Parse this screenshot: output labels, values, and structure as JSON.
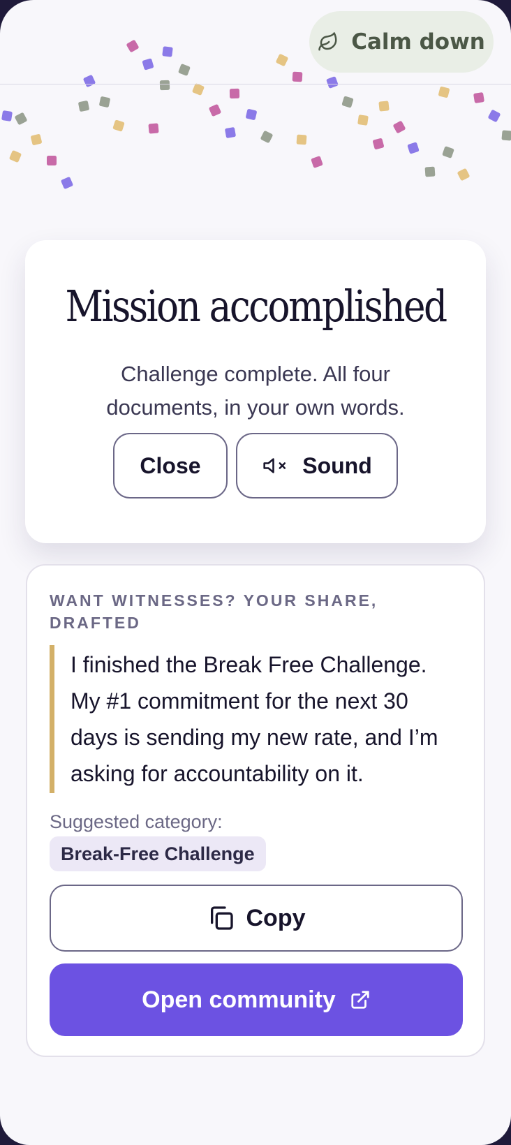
{
  "calm": {
    "label": "Calm down",
    "icon": "leaf-icon"
  },
  "hero": {
    "title": "Mission accomplished",
    "subtitle": "Challenge complete. All four documents, in your own words.",
    "close_label": "Close",
    "sound_label": "Sound",
    "sound_icon": "speaker-muted-icon"
  },
  "share": {
    "heading": "WANT WITNESSES? YOUR SHARE, DRAFTED",
    "quote": "I finished the Break Free Challenge. My #1 commitment for the next 30 days is sending my new rate, and I’m asking for accountability on it.",
    "suggested_label": "Suggested category:",
    "category": "Break-Free Challenge",
    "copy_label": "Copy",
    "copy_icon": "copy-icon",
    "community_label": "Open community",
    "community_icon": "external-link-icon"
  },
  "colors": {
    "accent": "#6c52e2",
    "quote_bar": "#d3b068",
    "chip_bg": "#ece8f6",
    "calm_bg": "#e9eee6",
    "confetti": [
      "#c86aa8",
      "#8b7ae8",
      "#9aa294",
      "#e5c483"
    ]
  }
}
